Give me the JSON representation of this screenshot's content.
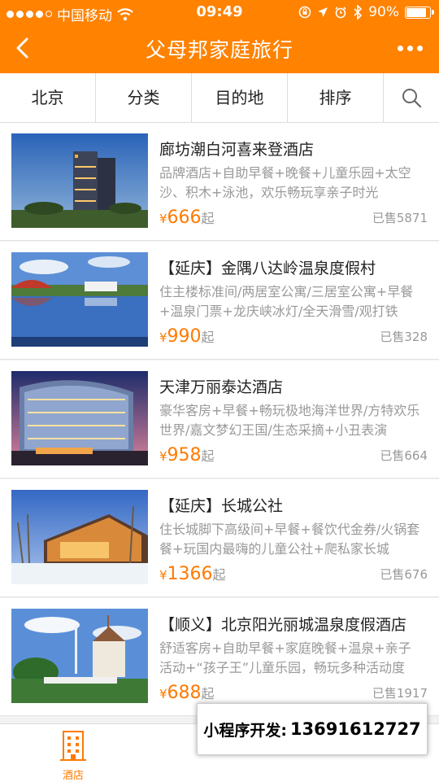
{
  "status_bar": {
    "carrier": "中国移动",
    "time": "09:49",
    "battery": "90%"
  },
  "navbar": {
    "title": "父母邦家庭旅行"
  },
  "filters": {
    "city": "北京",
    "category": "分类",
    "destination": "目的地",
    "sort": "排序"
  },
  "items": [
    {
      "name": "廊坊潮白河喜来登酒店",
      "desc": "品牌酒店+自助早餐+晚餐+儿童乐园+太空沙、积木+泳池，欢乐畅玩享亲子时光",
      "currency": "¥",
      "price": "666",
      "price_suffix": "起",
      "sold": "已售5871"
    },
    {
      "name": "【延庆】金隅八达岭温泉度假村",
      "desc": "住主楼标准间/两居室公寓/三居室公寓+早餐+温泉门票+龙庆峡冰灯/全天滑雪/观打铁",
      "currency": "¥",
      "price": "990",
      "price_suffix": "起",
      "sold": "已售328"
    },
    {
      "name": "天津万丽泰达酒店",
      "desc": "豪华客房+早餐+畅玩极地海洋世界/方特欢乐世界/嘉文梦幻王国/生态采摘+小丑表演",
      "currency": "¥",
      "price": "958",
      "price_suffix": "起",
      "sold": "已售664"
    },
    {
      "name": "【延庆】长城公社",
      "desc": "住长城脚下高级间+早餐+餐饮代金券/火锅套餐+玩国内最嗨的儿童公社+爬私家长城",
      "currency": "¥",
      "price": "1366",
      "price_suffix": "起",
      "sold": "已售676"
    },
    {
      "name": "【顺义】北京阳光丽城温泉度假酒店",
      "desc": "舒适客房+自助早餐+家庭晚餐+温泉+亲子活动+“孩子王”儿童乐园，畅玩多种活动度",
      "currency": "¥",
      "price": "688",
      "price_suffix": "起",
      "sold": "已售1917"
    }
  ],
  "tabbar": {
    "hotel_label": "酒店"
  },
  "promo": {
    "label": "小程序开发:",
    "phone": "13691612727"
  },
  "colors": {
    "accent": "#ff8200",
    "price": "#ff7a00",
    "muted": "#999999"
  }
}
